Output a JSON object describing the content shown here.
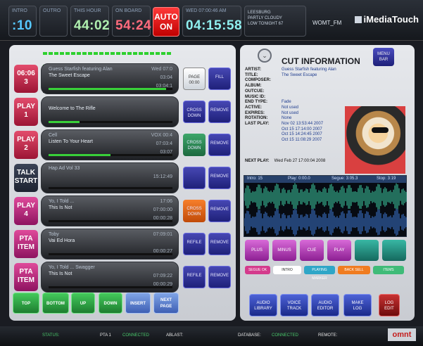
{
  "topbar": {
    "intro": {
      "label": "INTRO",
      "value": ":10",
      "color": "#56c8ff"
    },
    "outro": {
      "label": "OUTRO",
      "value": ""
    },
    "this_hour": {
      "label": "THIS HOUR",
      "value": "44:02",
      "color": "#b0f0b0"
    },
    "on_board": {
      "label": "ON BOARD",
      "value": "54:24",
      "color": "#ff6b7d"
    },
    "auto": {
      "line1": "AUTO",
      "line2": "ON"
    },
    "wed_clock": {
      "label": "WED 07:00:46 AM",
      "value": "04:15:58",
      "color": "#8ff0f0"
    },
    "weather": {
      "line1": "LEESBURG",
      "line2": "PARTLY CLOUDY",
      "line3": "LOW TONIGHT 67"
    },
    "station": "WOMT_FM",
    "brand": "iMediaTouch"
  },
  "carts": [
    {
      "slot": "06:06\n3",
      "slot_style": "slot-red",
      "title": "Guess Starfish featuring Alan",
      "subtitle": "The Sweet Escape",
      "t1": "Wed 07:0",
      "t2": "03:04",
      "t3": "03:04:1",
      "progress": 0.95,
      "b1": "PAGE\n00:00",
      "b1_style": "sb-white",
      "b2": "FILL",
      "b2_style": "sb-blue"
    },
    {
      "slot": "PLAY\n1",
      "slot_style": "slot-red",
      "title": "",
      "subtitle": "Welcome to The Rifle",
      "t1": "",
      "t2": "",
      "t3": "",
      "progress": 0.25,
      "b1": "CROSS\nDOWN",
      "b1_style": "sb-blue",
      "b2": "REMOVE",
      "b2_style": "sb-blue"
    },
    {
      "slot": "PLAY\n2",
      "slot_style": "slot-red",
      "title": "Cell",
      "subtitle": "Listen To Your Heart",
      "t1": "VOX 00:4",
      "t2": "07:03:4",
      "t3": "03:07",
      "progress": 0.5,
      "b1": "CROSS\nDOWN",
      "b1_style": "sb-green",
      "b2": "REMOVE",
      "b2_style": "sb-blue"
    },
    {
      "slot": "TALK\nSTART",
      "slot_style": "slot-dark",
      "title": "Hap Ad Vol 33",
      "subtitle": "",
      "t1": "",
      "t2": "15:12:49",
      "t3": "",
      "progress": 0,
      "b1": "",
      "b1_style": "sb-blue",
      "b2": "REMOVE",
      "b2_style": "sb-blue"
    },
    {
      "slot": "PLAY\n4",
      "slot_style": "slot-pink",
      "title": "Yo, I Told ...",
      "subtitle": "This Is Not",
      "t1": "17:06",
      "t2": "07:00:00",
      "t3": "00:00:28",
      "progress": 0,
      "b1": "CROSS\nDOWN",
      "b1_style": "sb-orange",
      "b2": "REMOVE",
      "b2_style": "sb-blue"
    },
    {
      "slot": "PTA\nITEM",
      "slot_style": "slot-pink",
      "title": "Toby",
      "subtitle": "Vai Ed Hora",
      "t1": "07:09:01",
      "t2": "",
      "t3": "00:00:27",
      "progress": 0,
      "b1": "REFILE",
      "b1_style": "sb-blue",
      "b2": "REMOVE",
      "b2_style": "sb-blue"
    },
    {
      "slot": "PTA\nITEM",
      "slot_style": "slot-pink",
      "title": "Yo, I Told ... Swagger",
      "subtitle": "This Is Not",
      "t1": "",
      "t2": "07:09:22",
      "t3": "00:00:29",
      "progress": 0,
      "b1": "REFILE",
      "b1_style": "sb-blue",
      "b2": "REMOVE",
      "b2_style": "sb-blue"
    }
  ],
  "bottom_buttons": [
    {
      "label": "TOP",
      "style": "bb-green"
    },
    {
      "label": "BOTTOM",
      "style": "bb-green"
    },
    {
      "label": "UP",
      "style": "bb-green"
    },
    {
      "label": "DOWN",
      "style": "bb-green"
    },
    {
      "label": "INSERT",
      "style": "bb-blue"
    },
    {
      "label": "NEXT\nPAGE",
      "style": "bb-blue"
    }
  ],
  "cut_info": {
    "heading": "CUT INFORMATION",
    "menu_button": "MENU\nBAR",
    "fields": [
      {
        "k": "ARTIST:",
        "v": "Guess Starfish featuring Alan"
      },
      {
        "k": "TITLE:",
        "v": "The Sweet Escape"
      },
      {
        "k": "COMPOSER:",
        "v": ""
      },
      {
        "k": "ALBUM:",
        "v": ""
      },
      {
        "k": "OUTCUE:",
        "v": ""
      },
      {
        "k": "MUSIC ID:",
        "v": ""
      },
      {
        "k": "END TYPE:",
        "v": "Fade"
      },
      {
        "k": "ACTIVE:",
        "v": "Not used"
      },
      {
        "k": "EXPIRES:",
        "v": "Not used"
      },
      {
        "k": "ROTATION:",
        "v": "None"
      },
      {
        "k": "LAST PLAY:",
        "v": "Nov 02 13:53:44 2007"
      },
      {
        "k": "",
        "v": "Oct 15 17:14:00 2007"
      },
      {
        "k": "",
        "v": "Oct 15 14:24:45 2007"
      },
      {
        "k": "",
        "v": "Oct 15 11:08:29 2007"
      }
    ],
    "next_play_label": "NEXT PLAY:",
    "next_play_value": "Wed Feb 27 17:00:04 2008"
  },
  "waveform": {
    "intro": "Intro: 15",
    "play": "Play: 0:00.0",
    "segue": "Segue: 3:05.3",
    "stop": "Stop: 3:19"
  },
  "cut_buttons": [
    {
      "label": "PLUS",
      "style": "cb-pink"
    },
    {
      "label": "MINUS",
      "style": "cb-pink"
    },
    {
      "label": "CUE",
      "style": "cb-pink"
    },
    {
      "label": "PLAY",
      "style": "cb-pink"
    },
    {
      "label": "",
      "style": "cb-teal"
    },
    {
      "label": "",
      "style": "cb-teal"
    }
  ],
  "tags": [
    {
      "label": "SEGUE OK",
      "color": "#d43a8c"
    },
    {
      "label": "INTRO",
      "color": "#ffffff"
    },
    {
      "label": "PLAYING MARKER",
      "color": "#2fa6c7"
    },
    {
      "label": "BACK SELL",
      "color": "#f07c20"
    },
    {
      "label": "ITEMS",
      "color": "#3fbb78"
    }
  ],
  "tools": [
    {
      "label": "AUDIO\nLIBRARY",
      "style": "bg-blue"
    },
    {
      "label": "VOICE\nTRACK",
      "style": "bg-blue"
    },
    {
      "label": "AUDIO\nEDITOR",
      "style": "bg-blue"
    },
    {
      "label": "MAKE\nLOG",
      "style": "bg-blue"
    },
    {
      "label": "LOG\nEDIT",
      "style": "bg-red"
    }
  ],
  "status": {
    "status_label": "STATUS:",
    "pta": "PTA 1",
    "pta_state": "CONNECTED",
    "ablast": "ABLAST:",
    "database": "DATABASE:",
    "db_state": "CONNECTED",
    "remote": "REMOTE:",
    "logo": "omnt"
  }
}
